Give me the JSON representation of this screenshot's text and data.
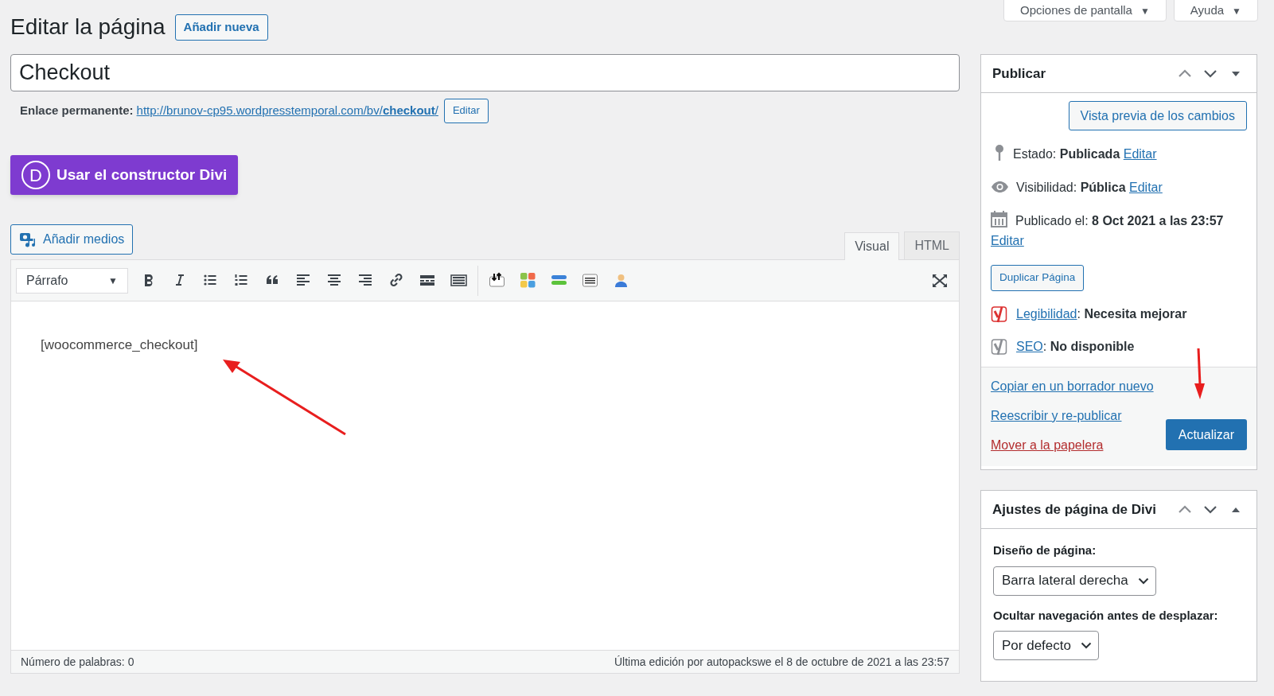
{
  "screen_tabs": [
    {
      "label": "Opciones de pantalla",
      "caret": "▼"
    },
    {
      "label": "Ayuda",
      "caret": "▼"
    }
  ],
  "heading": {
    "title": "Editar la página",
    "add_new_button": "Añadir nueva"
  },
  "title_field": {
    "value": "Checkout"
  },
  "permalink": {
    "label": "Enlace permanente:",
    "url": "http://brunov-cp95.wordpresstemporal.com/bv/**checkout**/",
    "edit_button": "Editar"
  },
  "divi_button": {
    "icon_letter": "D",
    "label": "Usar el constructor Divi"
  },
  "add_media_button": "Añadir medios",
  "editor_tabs": [
    {
      "label": "Visual",
      "selected": true
    },
    {
      "label": "HTML",
      "selected": false
    }
  ],
  "format_select": {
    "value": "Párrafo",
    "caret": "▼"
  },
  "content": "[woocommerce_checkout]",
  "status_bar": {
    "word_count": "Número de palabras: 0",
    "last_edit": "Última edición por autopackswe el 8 de octubre de 2021 a las 23:57"
  },
  "publish": {
    "title": "Publicar",
    "preview_button": "Vista previa de los cambios",
    "rows": [
      {
        "kind": "status",
        "text": "Estado: **Publicada**",
        "link": "Editar"
      },
      {
        "kind": "visibility",
        "text": "Visibilidad: **Pública**",
        "link": "Editar"
      },
      {
        "kind": "date",
        "text": "Publicado el: **8 Oct 2021 a las 23:57**",
        "link": "Editar"
      }
    ],
    "duplicate_button": "Duplicar Página",
    "seo_rows": [
      {
        "kind": "readability",
        "link": "Legibilidad",
        "text": ": **Necesita mejorar**"
      },
      {
        "kind": "seo",
        "link": "SEO",
        "text": ": **No disponible**"
      }
    ],
    "links": [
      "Copiar en un borrador nuevo",
      "Reescribir y re-publicar"
    ],
    "trash_link": "Mover a la papelera",
    "update_button": "Actualizar"
  },
  "divi_settings": {
    "title": "Ajustes de página de Divi",
    "fields": [
      {
        "label": "Diseño de página:",
        "value": "Barra lateral derecha"
      },
      {
        "label": "Ocultar navegación antes de desplazar:",
        "value": "Por defecto"
      }
    ]
  }
}
